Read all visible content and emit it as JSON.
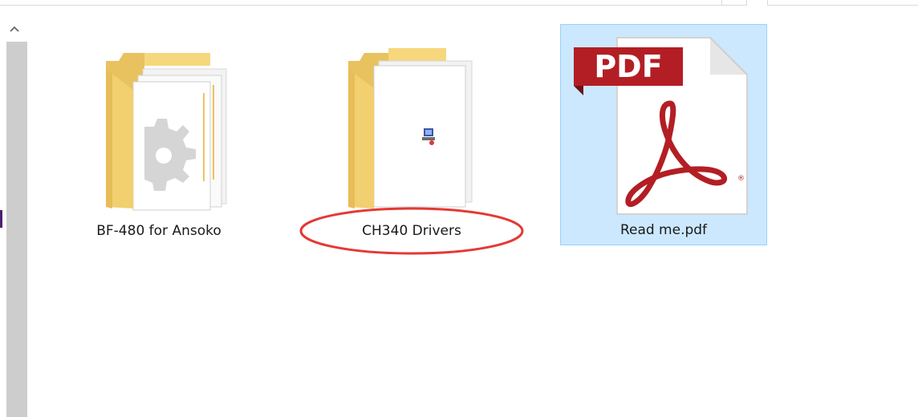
{
  "window": {
    "accent_selection": "#cce8ff",
    "accent_selection_border": "#99d1ff",
    "annotation_color": "#e53935"
  },
  "items": [
    {
      "name": "BF-480 for Ansoko",
      "type": "folder",
      "icon": "folder-icon",
      "selected": false,
      "circled": false
    },
    {
      "name": "CH340 Drivers",
      "type": "folder",
      "icon": "folder-icon",
      "selected": false,
      "circled": true
    },
    {
      "name": "Read me.pdf",
      "type": "pdf",
      "icon": "pdf-icon",
      "badge": "PDF",
      "selected": true,
      "circled": false
    }
  ],
  "scrollbar": {
    "icon": "chevron-up-icon"
  }
}
